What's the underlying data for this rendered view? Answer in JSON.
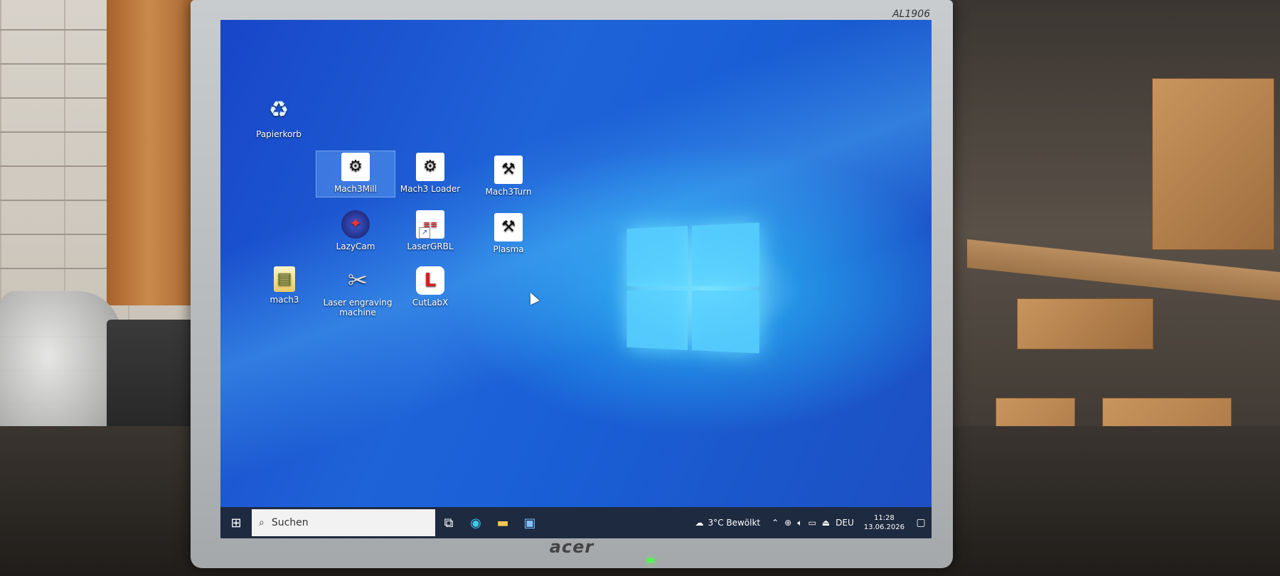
{
  "monitor": {
    "model": "AL1906",
    "brand": "acer"
  },
  "desktop_icons": [
    {
      "label": "Papierkorb",
      "icon": "recycle-bin-icon"
    },
    {
      "label": "Mach3Mill",
      "icon": "cnc-machine-icon"
    },
    {
      "label": "Mach3 Loader",
      "icon": "cnc-machine-icon"
    },
    {
      "label": "Mach3Turn",
      "icon": "lathe-icon"
    },
    {
      "label": "LazyCam",
      "icon": "lazycam-icon"
    },
    {
      "label": "LaserGRBL",
      "icon": "lasergrbl-icon"
    },
    {
      "label": "Plasma",
      "icon": "lathe-icon"
    },
    {
      "label": "mach3",
      "icon": "folder-icon"
    },
    {
      "label": "Laser engraving machine",
      "icon": "tools-icon"
    },
    {
      "label": "CutLabX",
      "icon": "cutlabx-icon"
    }
  ],
  "taskbar": {
    "search_placeholder": "Suchen",
    "weather": "3°C  Bewölkt",
    "language": "DEU",
    "time": "11:28",
    "date": "13.06.2026"
  }
}
